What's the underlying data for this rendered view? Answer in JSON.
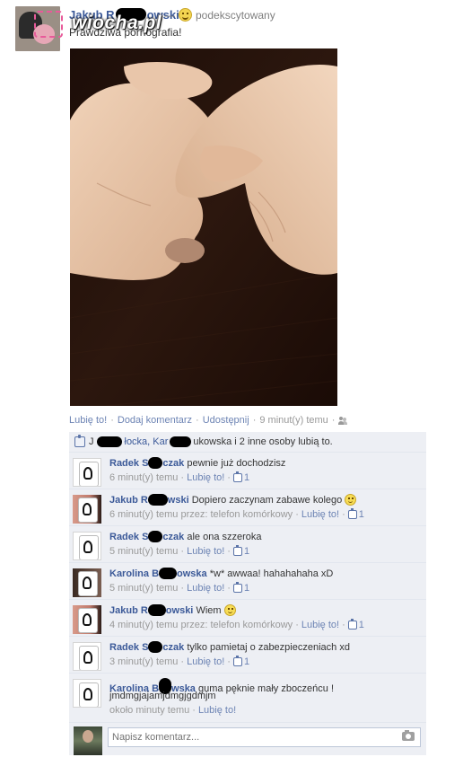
{
  "post": {
    "author_first": "Jakub R",
    "author_last": "owski",
    "feeling_sep": "—",
    "feeling": "podekscytowany",
    "text": "Prawdziwa pornografia!",
    "watermark": "wiocha.pl"
  },
  "actions": {
    "like": "Lubię to!",
    "comment": "Dodaj komentarz",
    "share": "Udostępnij",
    "time": "9 minut(y) temu"
  },
  "likes": {
    "part1": "J",
    "part2": "łocka, Kar",
    "part3": "ukowska i 2 inne osoby lubią to."
  },
  "comments": [
    {
      "name_a": "Radek S",
      "name_b": "czak",
      "text": "pewnie już dochodzisz",
      "time": "6 minut(y) temu",
      "like": "Lubię to!",
      "likes": "1"
    },
    {
      "name_a": "Jakub R",
      "name_b": "wski",
      "text": "Dopiero zaczynam zabawe kolego",
      "time": "6 minut(y) temu przez: telefon komórkowy",
      "like": "Lubię to!",
      "likes": "1"
    },
    {
      "name_a": "Radek S",
      "name_b": "czak",
      "text": "ale ona szzeroka",
      "time": "5 minut(y) temu",
      "like": "Lubię to!",
      "likes": "1"
    },
    {
      "name_a": "Karolina B",
      "name_b": "owska",
      "text": "*w* awwaa! hahahahaha xD",
      "time": "5 minut(y) temu",
      "like": "Lubię to!",
      "likes": "1"
    },
    {
      "name_a": "Jakub R",
      "name_b": "owski",
      "text": "Wiem",
      "time": "4 minut(y) temu przez: telefon komórkowy",
      "like": "Lubię to!",
      "likes": "1"
    },
    {
      "name_a": "Radek S",
      "name_b": "czak",
      "text": "tylko pamietaj o zabezpieczeniach xd",
      "time": "3 minut(y) temu",
      "like": "Lubię to!",
      "likes": "1"
    },
    {
      "name_a": "Karolina B",
      "name_b": "wska",
      "text": "guma pęknie mały zboczeńcu !",
      "text2": "jmdmgjajamjdmgjgdmjm",
      "time": "około minuty temu",
      "like": "Lubię to!"
    }
  ],
  "composer": {
    "placeholder": "Napisz komentarz..."
  },
  "icons": {
    "feeling": "smiley-icon",
    "audience": "friends-icon",
    "like": "thumbs-up-icon",
    "camera": "camera-icon"
  }
}
